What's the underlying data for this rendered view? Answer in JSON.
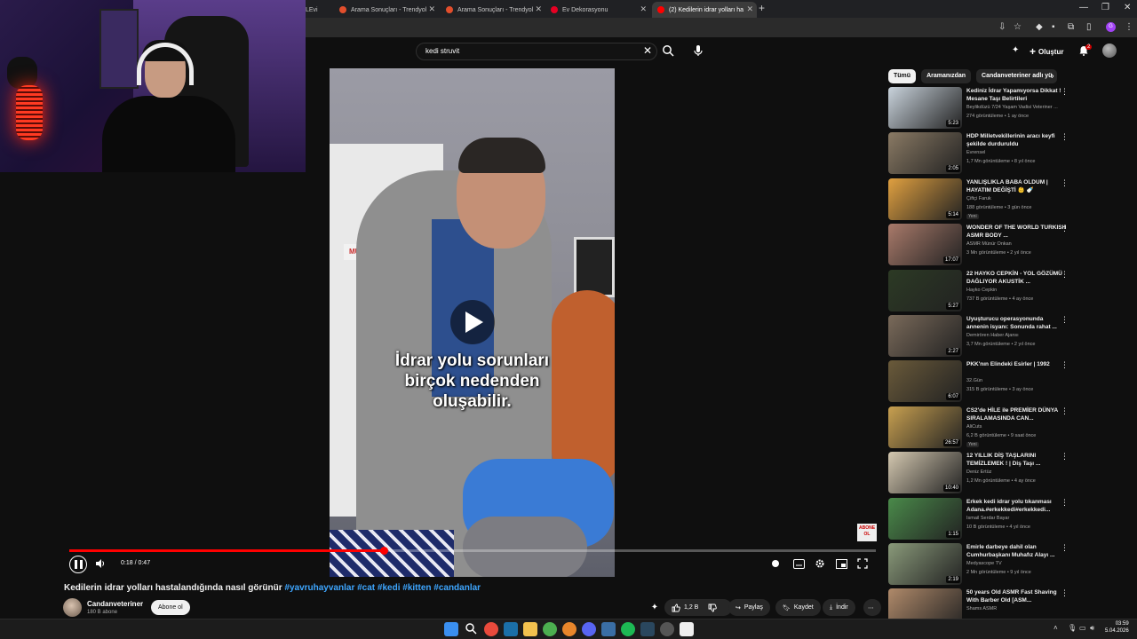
{
  "browser": {
    "tabs": [
      {
        "label": "LEvi",
        "active": false
      },
      {
        "label": "Arama Sonuçları - Trendyol",
        "active": false
      },
      {
        "label": "Arama Sonuçları - Trendyol",
        "active": false
      },
      {
        "label": "Ev Dekorasyonu",
        "active": false
      },
      {
        "label": "(2) Kedilerin idrar yolları ha",
        "active": true
      }
    ]
  },
  "search": {
    "query": "kedi struvit"
  },
  "header": {
    "create_label": "Oluştur",
    "notification_count": "2"
  },
  "video": {
    "caption_line1": "İdrar yolu sorunları",
    "caption_line2": "birçok nedenden",
    "caption_line3": "oluşabilir.",
    "door_sign": "MUAYEN",
    "watermark": "ABONE OL",
    "time": "0:18 / 0:47",
    "progress": 0.39,
    "title_main": "Kedilerin idrar yolları hastalandığında nasıl görünür",
    "title_tags": "#yavruhayvanlar #cat #kedi #kitten #candanlar"
  },
  "channel": {
    "name": "Candanveteriner",
    "subs": "180 B abone",
    "subscribe_label": "Abone ol"
  },
  "actions": {
    "likes": "1,2 B",
    "share": "Paylaş",
    "save": "Kaydet",
    "download": "İndir"
  },
  "chips": [
    "Tümü",
    "Aramanızdan",
    "Candanveteriner adlı yü"
  ],
  "related": [
    {
      "title": "Kediniz İdrar Yapamıyorsa Dikkat ! Mesane Taşı Belirtileri",
      "channel": "Beylikdüzü 7/24 Yaşam Vadisi Veteriner ...",
      "meta": "274 görüntüleme • 1 ay önce",
      "duration": "5:23",
      "new": "",
      "color": "#c9d3dc"
    },
    {
      "title": "HDP Milletvekillerinin aracı keyfi şekilde durduruldu",
      "channel": "Evrensel",
      "meta": "1,7 Mn görüntüleme • 8 yıl önce",
      "duration": "2:05",
      "new": "",
      "color": "#8a7a64"
    },
    {
      "title": "YANLIŞLIKLA BABA OLDUM | HAYATIM DEĞİŞTİ 👶 🍼",
      "channel": "Çiftçi Faruk",
      "meta": "188 görüntüleme • 3 gün önce",
      "duration": "5:14",
      "new": "Yeni",
      "color": "#e0a040"
    },
    {
      "title": "WONDER OF THE WORLD TURKISH ASMR BODY ...",
      "channel": "ASMR Münür Önkan",
      "meta": "3 Mn görüntüleme • 2 yıl önce",
      "duration": "17:07",
      "new": "",
      "color": "#a97a6a"
    },
    {
      "title": "22 HAYKO CEPKİN - YOL GÖZÜMÜ DAĞLIYOR AKUSTİK ...",
      "channel": "Hayko Cepkin",
      "meta": "737 B görüntüleme • 4 ay önce",
      "duration": "5:27",
      "new": "",
      "color": "#2c3a24"
    },
    {
      "title": "Uyuşturucu operasyonunda annenin isyanı: Sonunda rahat ...",
      "channel": "Demirören Haber Ajansı",
      "meta": "3,7 Mn görüntüleme • 2 yıl önce",
      "duration": "2:27",
      "new": "",
      "color": "#7a6a5a"
    },
    {
      "title": "PKK'nın Elindeki Esirler | 1992",
      "channel": "32.Gün",
      "meta": "315 B görüntüleme • 3 ay önce",
      "duration": "6:07",
      "new": "",
      "color": "#6a5a3a"
    },
    {
      "title": "CS2'de HİLE ile PREMİER DÜNYA SIRALAMASINDA CAN...",
      "channel": "AliCuts",
      "meta": "6,2 B görüntüleme • 9 saat önce",
      "duration": "26:57",
      "new": "Yeni",
      "color": "#c8a050"
    },
    {
      "title": "12 YILLIK DİŞ TAŞLARINI TEMİZLEMEK ! | Diş Taşı ...",
      "channel": "Deniz Ertüz",
      "meta": "1,2 Mn görüntüleme • 4 ay önce",
      "duration": "10:40",
      "new": "",
      "color": "#d4c8b0"
    },
    {
      "title": "Erkek kedi idrar yolu tıkanması Adana.#erkekkedi#erkekkedi...",
      "channel": "İsmail Serdar Bayar",
      "meta": "10 B görüntüleme • 4 yıl önce",
      "duration": "1:15",
      "new": "",
      "color": "#4a8a4a"
    },
    {
      "title": "Emirle darbeye dahil olan Cumhurbaşkanı Muhafız Alayı ...",
      "channel": "Medyascope TV",
      "meta": "2 Mn görüntüleme • 9 yıl önce",
      "duration": "2:19",
      "new": "",
      "color": "#8a9a7a"
    },
    {
      "title": "50 years Old ASMR Fast Shaving With Barber Old [ASM...",
      "channel": "Shams ASMR",
      "meta": "",
      "duration": "",
      "new": "",
      "color": "#b08a6a"
    }
  ],
  "taskbar": {
    "time": "03:59",
    "date": "5.04.2026"
  }
}
